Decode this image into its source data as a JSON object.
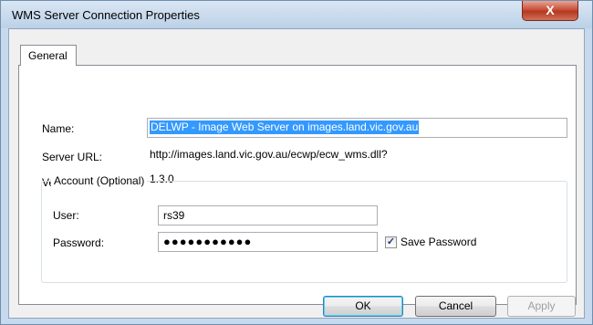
{
  "window": {
    "title": "WMS Server Connection Properties",
    "close_label": "X"
  },
  "tabs": [
    {
      "label": "General"
    }
  ],
  "general": {
    "name_label": "Name:",
    "name_value": "DELWP - Image Web Server on images.land.vic.gov.au",
    "server_url_label": "Server URL:",
    "server_url_value": "http://images.land.vic.gov.au/ecwp/ecw_wms.dll?",
    "version_label": "Version:",
    "version_value": "1.3.0"
  },
  "account": {
    "legend": "Account (Optional)",
    "user_label": "User:",
    "user_value": "rs39",
    "password_label": "Password:",
    "password_mask": "●●●●●●●●●●●",
    "save_password_label": "Save Password",
    "save_password_checked": true
  },
  "buttons": {
    "ok": "OK",
    "cancel": "Cancel",
    "apply": "Apply"
  }
}
